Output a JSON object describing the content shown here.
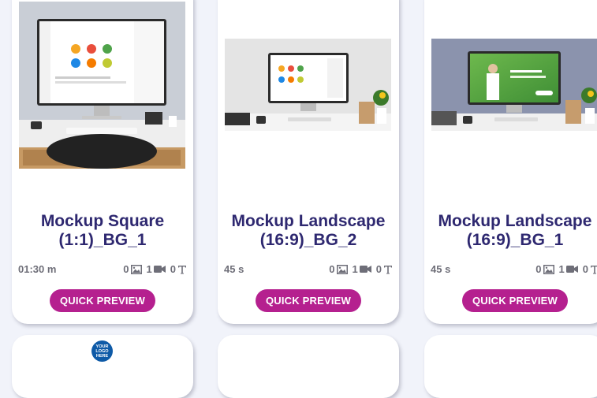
{
  "cards": [
    {
      "title_line1": "Mockup Square",
      "title_line2": "(1:1)_BG_1",
      "duration": "01:30 m",
      "images": "0",
      "videos": "1",
      "texts": "0",
      "preview_label": "QUICK PREVIEW"
    },
    {
      "title_line1": "Mockup Landscape",
      "title_line2": "(16:9)_BG_2",
      "duration": "45 s",
      "images": "0",
      "videos": "1",
      "texts": "0",
      "preview_label": "QUICK PREVIEW"
    },
    {
      "title_line1": "Mockup Landscape",
      "title_line2": "(16:9)_BG_1",
      "duration": "45 s",
      "images": "0",
      "videos": "1",
      "texts": "0",
      "preview_label": "QUICK PREVIEW"
    }
  ],
  "bottom_logo_text": "YOUR LOGO HERE",
  "colors": {
    "accent": "#b5208f",
    "title": "#2e2870",
    "meta": "#6e6e78",
    "background": "#f1f3fa"
  },
  "icons": [
    "image-icon",
    "video-icon",
    "text-icon"
  ]
}
